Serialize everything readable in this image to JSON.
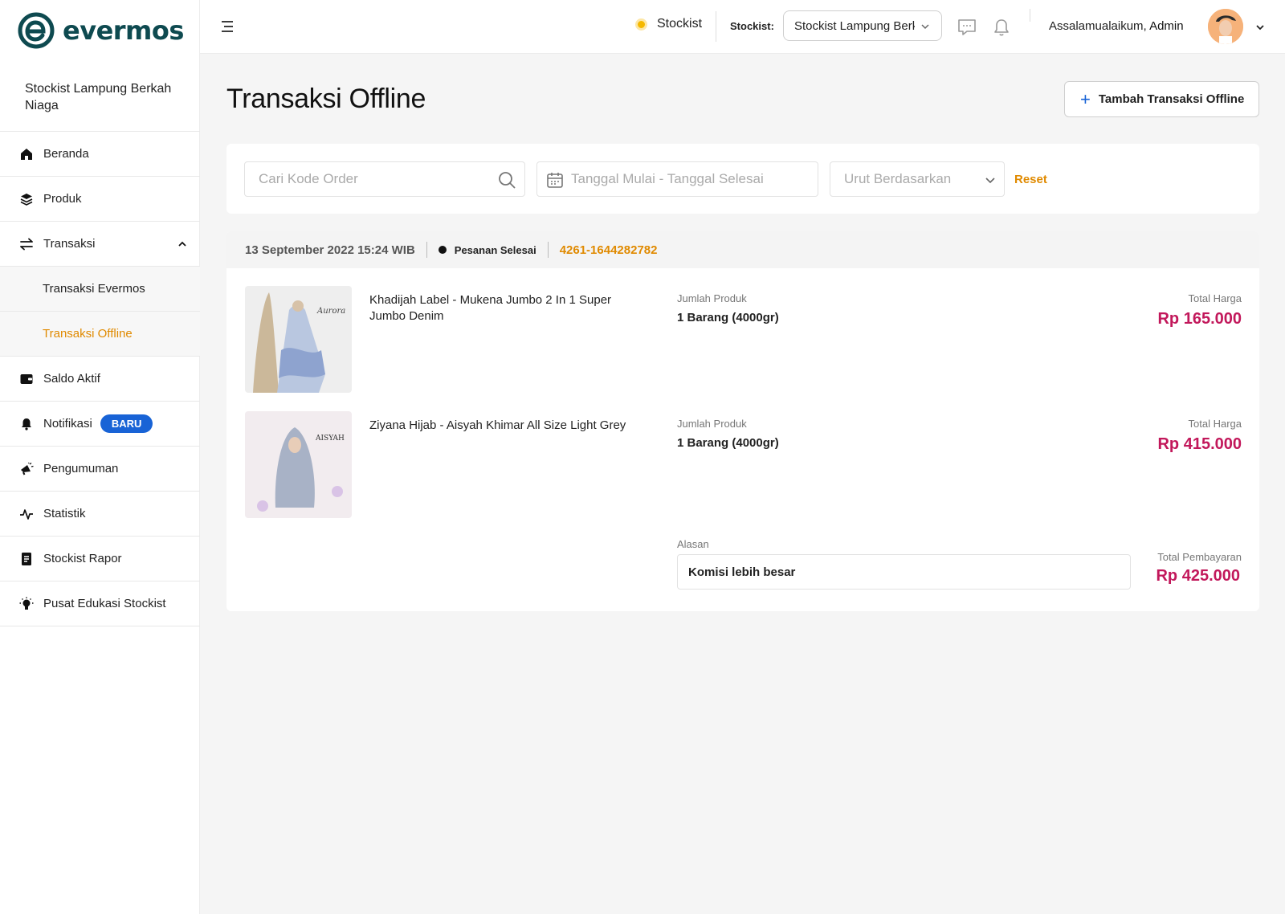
{
  "brand": {
    "name": "evermos",
    "color": "#0e4a50"
  },
  "sidebar": {
    "store_name": "Stockist Lampung Berkah Niaga",
    "items": [
      {
        "label": "Beranda",
        "icon": "home-icon"
      },
      {
        "label": "Produk",
        "icon": "layers-icon"
      },
      {
        "label": "Transaksi",
        "icon": "transfer-icon",
        "expanded": true
      },
      {
        "label": "Transaksi Evermos"
      },
      {
        "label": "Transaksi Offline",
        "active": true
      },
      {
        "label": "Saldo Aktif",
        "icon": "wallet-icon"
      },
      {
        "label": "Notifikasi",
        "icon": "bell-icon",
        "badge": "BARU"
      },
      {
        "label": "Pengumuman",
        "icon": "megaphone-icon"
      },
      {
        "label": "Statistik",
        "icon": "activity-icon"
      },
      {
        "label": "Stockist Rapor",
        "icon": "report-icon"
      },
      {
        "label": "Pusat Edukasi Stockist",
        "icon": "lightbulb-icon"
      }
    ]
  },
  "topbar": {
    "role": "Stockist",
    "stockist_label": "Stockist:",
    "stockist_selected": "Stockist Lampung Berkah Niaga",
    "greeting": "Assalamualaikum,",
    "user": "Admin"
  },
  "page": {
    "title": "Transaksi Offline",
    "add_button": "Tambah Transaksi Offline"
  },
  "filters": {
    "search_placeholder": "Cari Kode Order",
    "date_placeholder": "Tanggal Mulai - Tanggal Selesai",
    "sort_placeholder": "Urut Berdasarkan",
    "reset": "Reset"
  },
  "order": {
    "date": "13 September 2022 15:24 WIB",
    "status": "Pesanan Selesai",
    "code": "4261-1644282782",
    "qty_label": "Jumlah Produk",
    "price_label": "Total Harga",
    "products": [
      {
        "name": "Khadijah Label - Mukena Jumbo 2 In 1 Super Jumbo Denim",
        "qty": "1 Barang (4000gr)",
        "price": "Rp 165.000",
        "image_text": "Aurora"
      },
      {
        "name": "Ziyana Hijab - Aisyah Khimar All Size Light Grey",
        "qty": "1 Barang (4000gr)",
        "price": "Rp 415.000",
        "image_text": "AISYAH"
      }
    ],
    "reason_label": "Alasan",
    "reason": "Komisi lebih besar",
    "total_label": "Total Pembayaran",
    "total": "Rp 425.000"
  },
  "colors": {
    "accent": "#e08a00",
    "price": "#c2185b",
    "badge": "#1863d6"
  }
}
